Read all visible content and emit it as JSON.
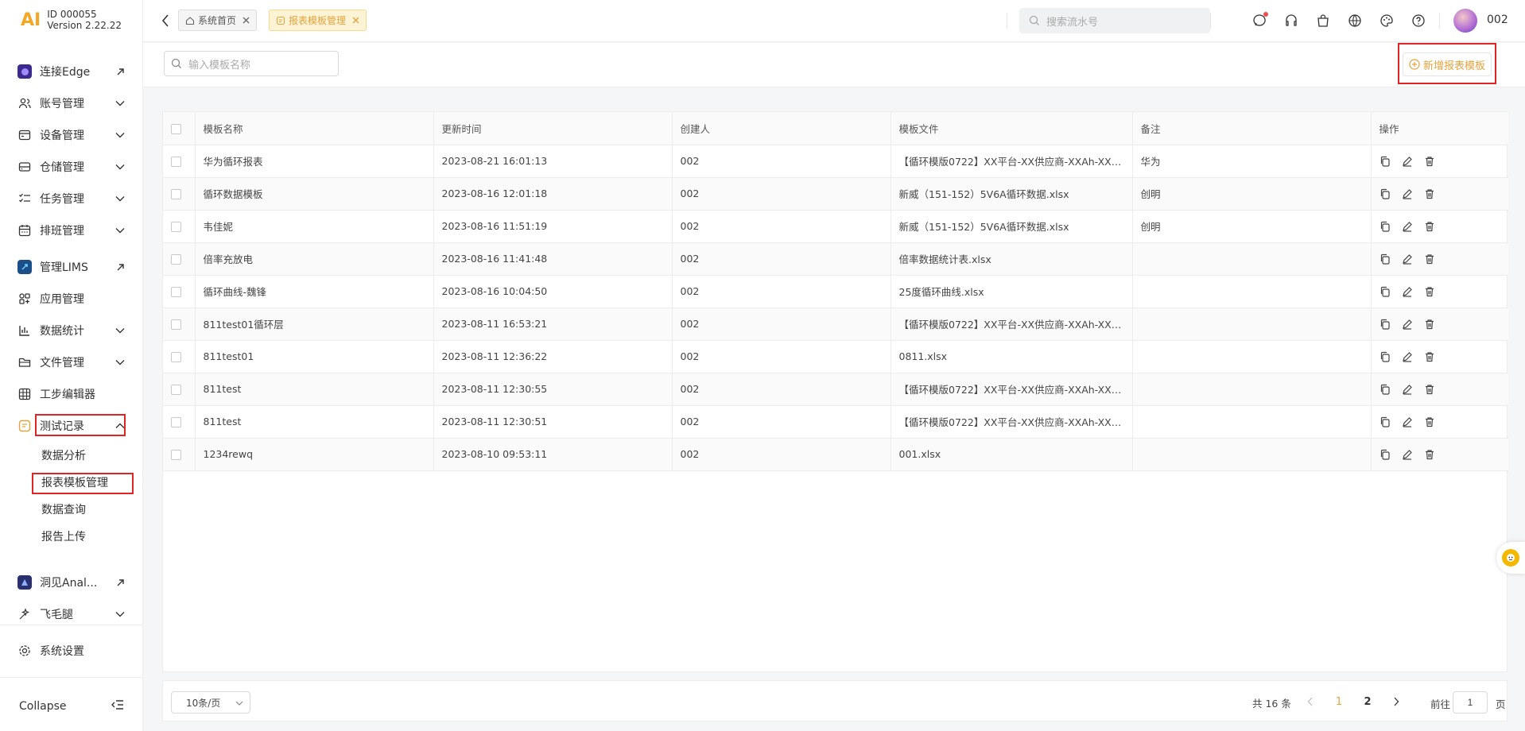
{
  "brand": {
    "logo": "AI",
    "id": "ID 000055",
    "version": "Version 2.22.22"
  },
  "sidebar": {
    "items": [
      {
        "label": "连接Edge",
        "icon": "external-app-icon",
        "tail": "arrow-up-right-icon"
      },
      {
        "label": "账号管理",
        "icon": "users-icon",
        "tail": "chevron-down-icon"
      },
      {
        "label": "设备管理",
        "icon": "device-icon",
        "tail": "chevron-down-icon"
      },
      {
        "label": "仓储管理",
        "icon": "storage-icon",
        "tail": "chevron-down-icon"
      },
      {
        "label": "任务管理",
        "icon": "task-list-icon",
        "tail": "chevron-down-icon"
      },
      {
        "label": "排班管理",
        "icon": "calendar-icon",
        "tail": "chevron-down-icon"
      },
      {
        "label": "管理LIMS",
        "icon": "lims-icon",
        "tail": "arrow-up-right-icon"
      },
      {
        "label": "应用管理",
        "icon": "apps-icon",
        "tail": ""
      },
      {
        "label": "数据统计",
        "icon": "bar-chart-icon",
        "tail": "chevron-down-icon"
      },
      {
        "label": "文件管理",
        "icon": "folder-icon",
        "tail": "chevron-down-icon"
      },
      {
        "label": "工步编辑器",
        "icon": "grid-icon",
        "tail": ""
      },
      {
        "label": "测试记录",
        "icon": "record-icon",
        "tail": "chevron-up-icon"
      }
    ],
    "subitems": [
      "数据分析",
      "报表模板管理",
      "数据查询",
      "报告上传"
    ],
    "bottom_items": [
      {
        "label": "洞见Anal...",
        "icon": "analytics-icon",
        "tail": "arrow-up-right-icon"
      },
      {
        "label": "飞毛腿",
        "icon": "sparkle-icon",
        "tail": "chevron-down-icon"
      }
    ],
    "settings": "系统设置",
    "collapse": "Collapse"
  },
  "topbar": {
    "tabs": [
      {
        "label": "系统首页",
        "active": false
      },
      {
        "label": "报表模板管理",
        "active": true
      }
    ],
    "search_placeholder": "搜索流水号",
    "username": "002"
  },
  "filter": {
    "placeholder": "输入模板名称",
    "add_label": "新增报表模板"
  },
  "table": {
    "headers": [
      "模板名称",
      "更新时间",
      "创建人",
      "模板文件",
      "备注",
      "操作"
    ],
    "rows": [
      [
        "华为循环报表",
        "2023-08-21 16:01:13",
        "002",
        "【循环模版0722】XX平台-XX供应商-XXAh-XX批...",
        "华为"
      ],
      [
        "循环数据模板",
        "2023-08-16 12:01:18",
        "002",
        "新威（151-152）5V6A循环数据.xlsx",
        "创明"
      ],
      [
        "韦佳妮",
        "2023-08-16 11:51:19",
        "002",
        "新威（151-152）5V6A循环数据.xlsx",
        "创明"
      ],
      [
        "倍率充放电",
        "2023-08-16 11:41:48",
        "002",
        "倍率数据统计表.xlsx",
        ""
      ],
      [
        "循环曲线-魏锋",
        "2023-08-16 10:04:50",
        "002",
        "25度循环曲线.xlsx",
        ""
      ],
      [
        "811test01循环层",
        "2023-08-11 16:53:21",
        "002",
        "【循环模版0722】XX平台-XX供应商-XXAh-XX批...",
        ""
      ],
      [
        "811test01",
        "2023-08-11 12:36:22",
        "002",
        "0811.xlsx",
        ""
      ],
      [
        "811test",
        "2023-08-11 12:30:55",
        "002",
        "【循环模版0722】XX平台-XX供应商-XXAh-XX批...",
        ""
      ],
      [
        "811test",
        "2023-08-11 12:30:51",
        "002",
        "【循环模版0722】XX平台-XX供应商-XXAh-XX批...",
        ""
      ],
      [
        "1234rewq",
        "2023-08-10 09:53:11",
        "002",
        "001.xlsx",
        ""
      ]
    ]
  },
  "pagination": {
    "page_size": "10条/页",
    "total": "共 16 条",
    "pages": [
      "1",
      "2"
    ],
    "current": "1",
    "goto_label": "前往",
    "goto_value": "1",
    "page_suffix": "页"
  },
  "colors": {
    "accent": "#e6a23c",
    "highlight": "#e02424"
  }
}
